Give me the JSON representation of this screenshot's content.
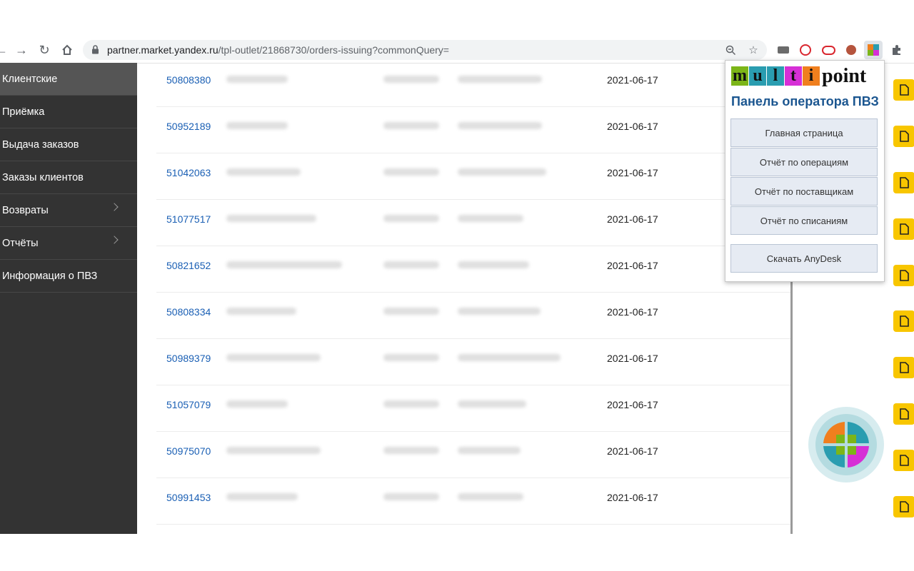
{
  "browser": {
    "url_host": "partner.market.yandex.ru",
    "url_path": "/tpl-outlet/21868730/orders-issuing?commonQuery="
  },
  "sidebar": {
    "items": [
      {
        "label": "Клиентские",
        "active": true,
        "chevron": false
      },
      {
        "label": "Приёмка",
        "active": false,
        "chevron": false
      },
      {
        "label": "Выдача заказов",
        "active": false,
        "chevron": false
      },
      {
        "label": "Заказы клиентов",
        "active": false,
        "chevron": false
      },
      {
        "label": "Возвраты",
        "active": false,
        "chevron": true
      },
      {
        "label": "Отчёты",
        "active": false,
        "chevron": true
      },
      {
        "label": "Информация о ПВЗ",
        "active": false,
        "chevron": false
      }
    ]
  },
  "orders": {
    "rows": [
      {
        "id": "50808380",
        "date": "2021-06-17"
      },
      {
        "id": "50952189",
        "date": "2021-06-17"
      },
      {
        "id": "51042063",
        "date": "2021-06-17"
      },
      {
        "id": "51077517",
        "date": "2021-06-17"
      },
      {
        "id": "50821652",
        "date": "2021-06-17"
      },
      {
        "id": "50808334",
        "date": "2021-06-17"
      },
      {
        "id": "50989379",
        "date": "2021-06-17"
      },
      {
        "id": "51057079",
        "date": "2021-06-17"
      },
      {
        "id": "50975070",
        "date": "2021-06-17"
      },
      {
        "id": "50991453",
        "date": "2021-06-17"
      }
    ]
  },
  "popup": {
    "logo_letters": [
      "m",
      "u",
      "l",
      "t",
      "i"
    ],
    "logo_word": "point",
    "title": "Панель оператора ПВЗ",
    "buttons": [
      "Главная страница",
      "Отчёт по операциям",
      "Отчёт по поставщикам",
      "Отчёт по списаниям",
      "Скачать AnyDesk"
    ]
  },
  "colors": {
    "sidebar_bg": "#333333",
    "link": "#1a5fb4",
    "doc_button": "#f8c600",
    "popup_title": "#1b5690",
    "logo_tiles": [
      "#7cb518",
      "#2a9db0",
      "#f07f1e",
      "#d62fd6",
      "#f07f1e"
    ]
  }
}
